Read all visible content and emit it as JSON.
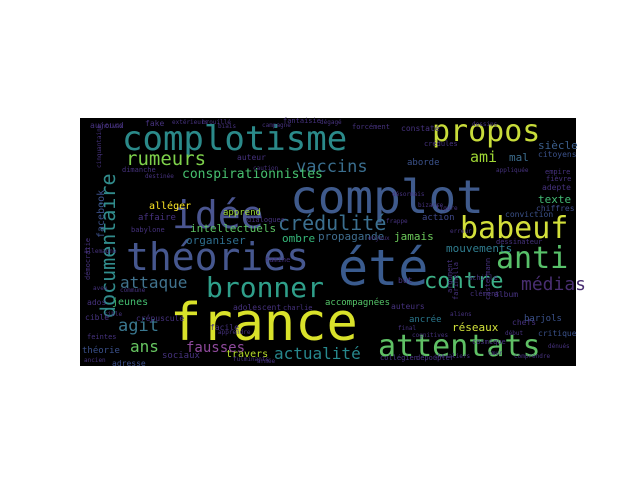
{
  "wordcloud": {
    "background_color": "#000000",
    "words": [
      {
        "text": "complot",
        "color": "#3f5a8c"
      },
      {
        "text": "france",
        "color": "#d9e22a"
      },
      {
        "text": "été",
        "color": "#3a5b8e"
      },
      {
        "text": "complotisme",
        "color": "#2b8a8a"
      },
      {
        "text": "théories",
        "color": "#46578f"
      },
      {
        "text": "attentats",
        "color": "#5fc065"
      },
      {
        "text": "propos",
        "color": "#c8dc3a"
      },
      {
        "text": "idée",
        "color": "#4a5590"
      },
      {
        "text": "babeuf",
        "color": "#d3e03a"
      },
      {
        "text": "anti",
        "color": "#58c16a"
      },
      {
        "text": "bronner",
        "color": "#2f9f8a"
      },
      {
        "text": "contre",
        "color": "#3cb187"
      },
      {
        "text": "documentaire",
        "color": "#318c8c"
      },
      {
        "text": "crédulité",
        "color": "#3b6f8f"
      },
      {
        "text": "rumeurs",
        "color": "#7ed14b"
      },
      {
        "text": "vaccins",
        "color": "#3a6e8e"
      },
      {
        "text": "médias",
        "color": "#482e71"
      },
      {
        "text": "attaque",
        "color": "#41738e"
      },
      {
        "text": "actualité",
        "color": "#27888d"
      },
      {
        "text": "agit",
        "color": "#3a7890"
      },
      {
        "text": "ans",
        "color": "#67c661"
      },
      {
        "text": "fausses",
        "color": "#8f4a9c"
      },
      {
        "text": "ami",
        "color": "#9fd734"
      },
      {
        "text": "conspirationnistes",
        "color": "#47c06f"
      },
      {
        "text": "intellectuels",
        "color": "#5bc263"
      },
      {
        "text": "organiser",
        "color": "#2e6e8e"
      },
      {
        "text": "mouvements",
        "color": "#2f7c8e"
      },
      {
        "text": "propagande",
        "color": "#3f6d8f"
      },
      {
        "text": "réseaux",
        "color": "#d2e23a"
      },
      {
        "text": "siècle",
        "color": "#3b5e8c"
      },
      {
        "text": "jamais",
        "color": "#6cc95a"
      },
      {
        "text": "mal",
        "color": "#3c6d8e"
      },
      {
        "text": "texte",
        "color": "#43bb75"
      },
      {
        "text": "adepte",
        "color": "#46327e"
      },
      {
        "text": "chiffres",
        "color": "#3f4d8a"
      },
      {
        "text": "ombre",
        "color": "#35b779"
      },
      {
        "text": "adolescent",
        "color": "#46317d"
      },
      {
        "text": "accompagnées",
        "color": "#54c568"
      },
      {
        "text": "ados",
        "color": "#46327e"
      },
      {
        "text": "jeunes",
        "color": "#44bf70"
      },
      {
        "text": "sociaux",
        "color": "#46327e"
      },
      {
        "text": "travers",
        "color": "#b8de29"
      },
      {
        "text": "théorie",
        "color": "#3b518b"
      },
      {
        "text": "adresse",
        "color": "#3c4f8a"
      },
      {
        "text": "facebook",
        "color": "#3b518b"
      },
      {
        "text": "affaire",
        "color": "#46327e"
      },
      {
        "text": "apprend",
        "color": "#9fda3a"
      },
      {
        "text": "alléger",
        "color": "#fde725"
      },
      {
        "text": "aborde",
        "color": "#3b528b"
      },
      {
        "text": "action",
        "color": "#3f4889"
      },
      {
        "text": "auteur",
        "color": "#46327e"
      },
      {
        "text": "auteurs",
        "color": "#46327e"
      },
      {
        "text": "ancrée",
        "color": "#2a788e"
      },
      {
        "text": "barjols",
        "color": "#3b528b"
      },
      {
        "text": "critique",
        "color": "#3b528b"
      },
      {
        "text": "citoyens",
        "color": "#3b528b"
      },
      {
        "text": "conviction",
        "color": "#3b528b"
      },
      {
        "text": "album",
        "color": "#46327e"
      },
      {
        "text": "facile",
        "color": "#46327e"
      },
      {
        "text": "fake",
        "color": "#46327e"
      },
      {
        "text": "crépuscule",
        "color": "#46327e"
      },
      {
        "text": "aujourd",
        "color": "#46327e"
      },
      {
        "text": "cible",
        "color": "#46327e"
      },
      {
        "text": "constate",
        "color": "#46327e"
      },
      {
        "text": "forcément",
        "color": "#46327e"
      },
      {
        "text": "fantaisie",
        "color": "#46327e"
      },
      {
        "text": "démocratie",
        "color": "#46327e"
      },
      {
        "text": "feintes",
        "color": "#46327e"
      },
      {
        "text": "fièvre",
        "color": "#46327e"
      },
      {
        "text": "chefs",
        "color": "#46327e"
      },
      {
        "text": "but",
        "color": "#46327e"
      },
      {
        "text": "famine",
        "color": "#46327e"
      },
      {
        "text": "charlie",
        "color": "#46327e"
      },
      {
        "text": "empire",
        "color": "#46327e"
      },
      {
        "text": "dimanche",
        "color": "#46327e"
      },
      {
        "text": "dessinateur",
        "color": "#46327e"
      },
      {
        "text": "cosmique",
        "color": "#46327e"
      },
      {
        "text": "collégien",
        "color": "#46327e"
      },
      {
        "text": "dépoupler",
        "color": "#46327e"
      },
      {
        "text": "crédules",
        "color": "#46327e"
      },
      {
        "text": "babylone",
        "color": "#46327e"
      },
      {
        "text": "castermann",
        "color": "#46327e"
      },
      {
        "text": "clément",
        "color": "#46327e"
      },
      {
        "text": "achille",
        "color": "#46327e"
      },
      {
        "text": "dialogues",
        "color": "#46327e"
      },
      {
        "text": "farinella",
        "color": "#46327e"
      },
      {
        "text": "fulminants",
        "color": "#46327e"
      },
      {
        "text": "argument",
        "color": "#46327e"
      },
      {
        "text": "cognitives",
        "color": "#46327e"
      },
      {
        "text": "comprendre",
        "color": "#46327e"
      },
      {
        "text": "appliquée",
        "color": "#46327e"
      },
      {
        "text": "cinquantaine",
        "color": "#46327e"
      },
      {
        "text": "destinée",
        "color": "#46327e"
      },
      {
        "text": "dénués",
        "color": "#46327e"
      },
      {
        "text": "chevaliers",
        "color": "#46327e"
      },
      {
        "text": "extérieurs",
        "color": "#46327e"
      },
      {
        "text": "enjeux",
        "color": "#46327e"
      },
      {
        "text": "final",
        "color": "#46327e"
      },
      {
        "text": "caution",
        "color": "#46327e"
      },
      {
        "text": "allemagne",
        "color": "#46327e"
      },
      {
        "text": "campagne",
        "color": "#46327e"
      },
      {
        "text": "apprendre",
        "color": "#46327e"
      },
      {
        "text": "cœur",
        "color": "#46327e"
      },
      {
        "text": "aveu",
        "color": "#46327e"
      },
      {
        "text": "dégagé",
        "color": "#46327e"
      },
      {
        "text": "dessins",
        "color": "#46327e"
      },
      {
        "text": "biais",
        "color": "#46327e"
      },
      {
        "text": "bizarre",
        "color": "#46327e"
      },
      {
        "text": "désormais",
        "color": "#46327e"
      },
      {
        "text": "commune",
        "color": "#46327e"
      },
      {
        "text": "antivax",
        "color": "#46327e"
      },
      {
        "text": "aliens",
        "color": "#46327e"
      },
      {
        "text": "cible",
        "color": "#46327e"
      },
      {
        "text": "brouillé",
        "color": "#46327e"
      },
      {
        "text": "ancien",
        "color": "#46327e"
      },
      {
        "text": "armée",
        "color": "#46327e"
      },
      {
        "text": "figure",
        "color": "#46327e"
      },
      {
        "text": "frappe",
        "color": "#46327e"
      },
      {
        "text": "erreur",
        "color": "#46327e"
      },
      {
        "text": "début",
        "color": "#46327e"
      },
      {
        "text": "éditions",
        "color": "#46327e"
      }
    ]
  }
}
